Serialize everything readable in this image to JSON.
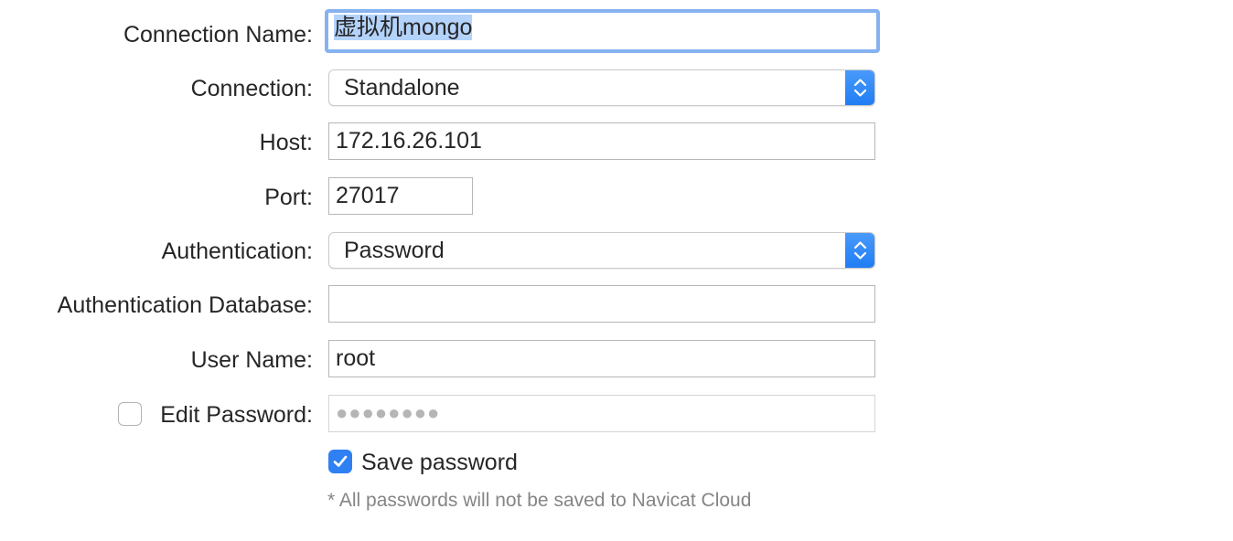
{
  "connection_name": {
    "label": "Connection Name:",
    "value": "虚拟机mongo"
  },
  "connection": {
    "label": "Connection:",
    "selected": "Standalone"
  },
  "host": {
    "label": "Host:",
    "value": "172.16.26.101"
  },
  "port": {
    "label": "Port:",
    "value": "27017"
  },
  "authentication": {
    "label": "Authentication:",
    "selected": "Password"
  },
  "auth_database": {
    "label": "Authentication Database:",
    "value": ""
  },
  "user_name": {
    "label": "User Name:",
    "value": "root"
  },
  "edit_password": {
    "label": "Edit Password:",
    "checked": false,
    "masked_value": "●●●●●●●●"
  },
  "save_password": {
    "label": "Save password",
    "checked": true
  },
  "note": "* All passwords will not be saved to Navicat Cloud",
  "colors": {
    "accent": "#2f80f3",
    "focus_ring": "#86b2f0",
    "selection": "#b3d3fb"
  },
  "icons": {
    "stepper": "chevron-up-down-icon",
    "check": "checkmark-icon"
  }
}
